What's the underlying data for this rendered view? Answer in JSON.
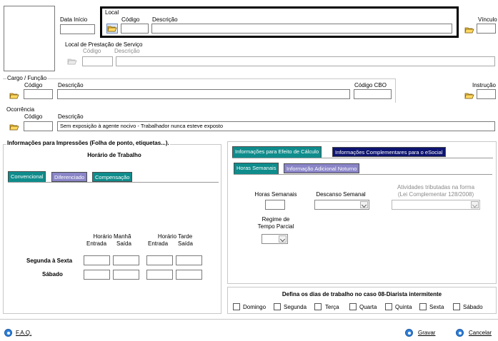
{
  "header": {
    "data_inicio_label": "Data Início",
    "local_legend": "Local",
    "local_codigo_label": "Código",
    "local_descricao_label": "Descrição",
    "local_codigo_value": "",
    "local_descricao_value": "",
    "vinculo_label": "Vínculo",
    "vinculo_value": "",
    "prestacao_legend": "Local de Prestação de Serviço",
    "prestacao_codigo_label": "Código",
    "prestacao_descricao_label": "Descrição"
  },
  "cargo": {
    "legend": "Cargo / Função",
    "codigo_label": "Código",
    "descricao_label": "Descrição",
    "cbo_label": "Código CBO",
    "instrucao_label": "Instrução"
  },
  "ocorrencia": {
    "legend": "Ocorrência",
    "codigo_label": "Código",
    "descricao_label": "Descrição",
    "descricao_value": "Sem exposição à agente nocivo - Trabalhador nunca esteve exposto"
  },
  "impressoes": {
    "legend": "Informações para Impressões (Folha de ponto, etiquetas...).",
    "horario_title": "Horário de Trabalho",
    "tabs": [
      "Convencional",
      "Diferenciado",
      "Compensação"
    ],
    "manha_label": "Horário Manhã",
    "tarde_label": "Horário Tarde",
    "entrada_label": "Entrada",
    "saida_label": "Saída",
    "rows": [
      "Segunda à Sexta",
      "Sábado"
    ]
  },
  "calculo": {
    "top_tabs": [
      "Informações para Efeito de Cálculo",
      "Informações Complementares para o eSocial"
    ],
    "sub_tabs": [
      "Horas Semanais",
      "Informação Adicional Noturno"
    ],
    "horas_semanais_label": "Horas Semanais",
    "descanso_label": "Descanso Semanal",
    "atividades_label_1": "Atividades tributadas na forma",
    "atividades_label_2": "(Lei Complementar 128/2008)",
    "regime_label_1": "Regime de",
    "regime_label_2": "Tempo Parcial"
  },
  "diarista": {
    "title": "Defina os dias de trabalho no caso 08-Diarista intermitente",
    "days": [
      "Domingo",
      "Segunda",
      "Terça",
      "Quarta",
      "Quinta",
      "Sexta",
      "Sábado"
    ]
  },
  "footer": {
    "faq": "F.A.Q.",
    "gravar": "Gravar",
    "cancelar": "Cancelar"
  },
  "colors": {
    "teal_tab": "#0f8c8c",
    "navy_tab": "#0d1470",
    "purple_tab": "#8a85c8",
    "button_blue": "#2f7fd8"
  },
  "icons": [
    "folder-open-icon",
    "help-icon",
    "save-icon",
    "cancel-icon"
  ]
}
